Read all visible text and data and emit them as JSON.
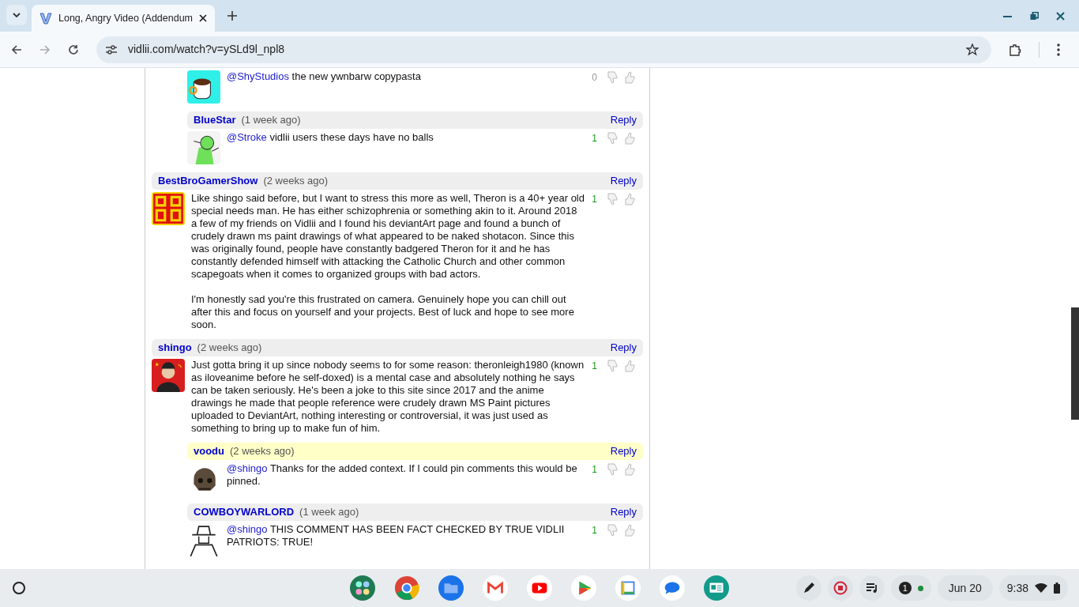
{
  "browser": {
    "tab_title": "Long, Angry Video (Addendum",
    "url": "vidlii.com/watch?v=ySLd9l_npl8"
  },
  "comments": [
    {
      "kind": "reply",
      "mention": "@ShyStudios",
      "paragraphs": [
        "the new ywnbarw copypasta"
      ],
      "score": "0",
      "positive": false
    },
    {
      "kind": "reply",
      "author": "BlueStar",
      "time": "(1 week ago)",
      "reply": "Reply",
      "highlighted": false,
      "mention": "@Stroke",
      "paragraphs": [
        "vidlii users these days have no balls"
      ],
      "score": "1",
      "positive": true
    },
    {
      "kind": "top",
      "author": "BestBroGamerShow",
      "time": "(2 weeks ago)",
      "reply": "Reply",
      "highlighted": false,
      "paragraphs": [
        "Like shingo said before, but I want to stress this more as well, Theron is a 40+ year old special needs man. He has either schizophrenia or something akin to it. Around 2018 a few of my friends on Vidlii and I found his deviantArt page and found a bunch of crudely drawn ms paint drawings of what appeared to be naked shotacon. Since this was originally found, people have constantly badgered Theron for it and he has constantly defended himself with attacking the Catholic Church and other common scapegoats when it comes to organized groups with bad actors.",
        "I'm honestly sad you're this frustrated on camera. Genuinely hope you can chill out after this and focus on yourself and your projects. Best of luck and hope to see more soon."
      ],
      "score": "1",
      "positive": true
    },
    {
      "kind": "top",
      "author": "shingo",
      "time": "(2 weeks ago)",
      "reply": "Reply",
      "highlighted": false,
      "paragraphs": [
        "Just gotta bring it up since nobody seems to for some reason: theronleigh1980 (known as iloveanime before he self-doxed) is a mental case and absolutely nothing he says can be taken seriously. He's been a joke to this site since 2017 and the anime drawings he made that people reference were crudely drawn MS Paint pictures uploaded to DeviantArt, nothing interesting or controversial, it was just used as something to bring up to make fun of him."
      ],
      "score": "1",
      "positive": true
    },
    {
      "kind": "reply",
      "author": "voodu",
      "time": "(2 weeks ago)",
      "reply": "Reply",
      "highlighted": true,
      "mention": "@shingo",
      "paragraphs": [
        "Thanks for the added context. If I could pin comments this would be pinned."
      ],
      "score": "1",
      "positive": true
    },
    {
      "kind": "reply",
      "author": "COWBOYWARLORD",
      "time": "(1 week ago)",
      "reply": "Reply",
      "highlighted": false,
      "mention": "@shingo",
      "paragraphs": [
        "THIS COMMENT HAS BEEN FACT CHECKED BY TRUE VIDLII PATRIOTS: TRUE!"
      ],
      "score": "1",
      "positive": true
    }
  ],
  "shelf": {
    "date": "Jun 20",
    "time": "9:38",
    "notifications": "1"
  }
}
